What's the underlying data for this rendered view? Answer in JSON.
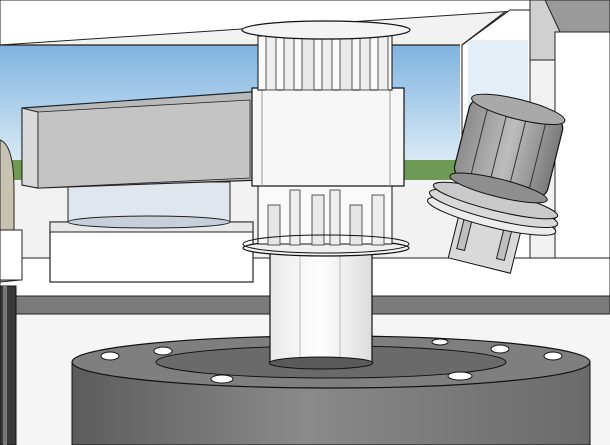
{
  "scene": {
    "description_hidden": "",
    "colors": {
      "sky_top": "#7fb3e0",
      "sky_bottom": "#cfe3f2",
      "ground": "#6f9a55",
      "room_white": "#f4f4f4",
      "machine_dark": "#6e6e6e",
      "machine_mid": "#9a9a9a",
      "part_white": "#f7f7f7",
      "outline": "#111111",
      "ring_blue": "#dfe6ee"
    }
  }
}
